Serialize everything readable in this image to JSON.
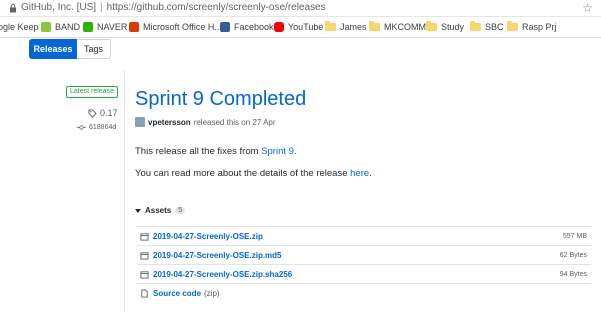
{
  "browser": {
    "site_label": "GitHub, Inc. [US]",
    "url": "https://github.com/screenly/screenly-ose/releases",
    "bookmarks": [
      {
        "label": "ogle Keep",
        "icon": "keep-icon"
      },
      {
        "label": "BAND",
        "icon": "band-icon"
      },
      {
        "label": "NAVER",
        "icon": "naver-icon"
      },
      {
        "label": "Microsoft Office H...",
        "icon": "office-icon"
      },
      {
        "label": "Facebook",
        "icon": "facebook-icon"
      },
      {
        "label": "YouTube",
        "icon": "youtube-icon"
      },
      {
        "label": "James",
        "icon": "folder-icon"
      },
      {
        "label": "MKCOMMS",
        "icon": "folder-icon"
      },
      {
        "label": "Study",
        "icon": "folder-icon"
      },
      {
        "label": "SBC",
        "icon": "folder-icon"
      },
      {
        "label": "Rasp Prj",
        "icon": "folder-icon"
      }
    ]
  },
  "subnav": {
    "releases": "Releases",
    "tags": "Tags"
  },
  "release": {
    "badge": "Latest release",
    "tag": "0.17",
    "commit": "618864d",
    "title": "Sprint 9 Completed",
    "author": "vpetersson",
    "released_text": "released this on 27 Apr",
    "p1_prefix": "This release all the fixes from ",
    "p1_link": "Sprint 9",
    "p1_suffix": ".",
    "p2_prefix": "You can read more about the details of the release ",
    "p2_link": "here",
    "p2_suffix": ".",
    "assets_label": "Assets",
    "assets_count": "5",
    "assets": [
      {
        "name": "2019-04-27-Screenly-OSE.zip",
        "size": "557 MB"
      },
      {
        "name": "2019-04-27-Screenly-OSE.zip.md5",
        "size": "62 Bytes"
      },
      {
        "name": "2019-04-27-Screenly-OSE.zip.sha256",
        "size": "94 Bytes"
      }
    ],
    "source_label": "Source code",
    "source_format": "(zip)"
  },
  "colors": {
    "accent": "#0366d6",
    "badge_green": "#28a745"
  }
}
